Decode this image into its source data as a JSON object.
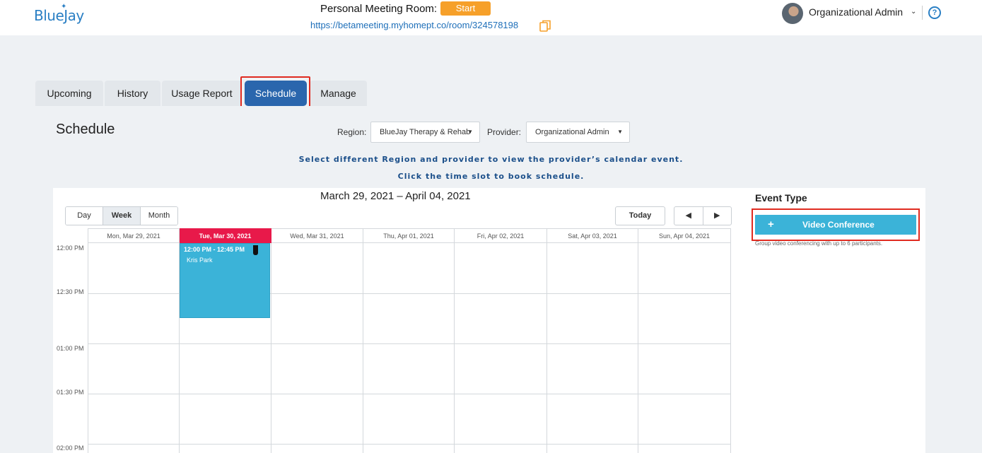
{
  "header": {
    "logo_text": "BlueJay",
    "meeting_room_label": "Personal Meeting Room:",
    "start_label": "Start",
    "room_url": "https://betameeting.myhomept.co/room/324578198",
    "user_name": "Organizational Admin",
    "help_symbol": "?",
    "icons": [
      "copy-icon",
      "avatar",
      "chevron-down-icon",
      "help-icon"
    ]
  },
  "tabs": [
    {
      "label": "Upcoming",
      "active": false
    },
    {
      "label": "History",
      "active": false
    },
    {
      "label": "Usage Report",
      "active": false
    },
    {
      "label": "Schedule",
      "active": true
    },
    {
      "label": "Manage",
      "active": false
    }
  ],
  "schedule": {
    "title": "Schedule",
    "region_label": "Region:",
    "region_value": "BlueJay Therapy & Rehab",
    "provider_label": "Provider:",
    "provider_value": "Organizational Admin",
    "hint_1": "Select different Region and provider to view the provider’s calendar event.",
    "hint_2": "Click the time slot to book schedule."
  },
  "calendar": {
    "range_title": "March 29, 2021 – April 04, 2021",
    "views": [
      {
        "label": "Day",
        "active": false
      },
      {
        "label": "Week",
        "active": true
      },
      {
        "label": "Month",
        "active": false
      }
    ],
    "today_label": "Today",
    "prev_symbol": "◀",
    "next_symbol": "▶",
    "days": [
      {
        "label": "Mon, Mar 29, 2021",
        "today": false
      },
      {
        "label": "Tue, Mar 30, 2021",
        "today": true
      },
      {
        "label": "Wed, Mar 31, 2021",
        "today": false
      },
      {
        "label": "Thu, Apr 01, 2021",
        "today": false
      },
      {
        "label": "Fri, Apr 02, 2021",
        "today": false
      },
      {
        "label": "Sat, Apr 03, 2021",
        "today": false
      },
      {
        "label": "Sun, Apr 04, 2021",
        "today": false
      }
    ],
    "time_slots": [
      "12:00 PM",
      "12:30 PM",
      "01:00 PM",
      "01:30 PM",
      "02:00 PM"
    ],
    "event": {
      "time": "12:00 PM - 12:45 PM",
      "name": "Kris Park",
      "day": "Tue, Mar 30, 2021",
      "color": "#3bb3d8"
    }
  },
  "event_type": {
    "title": "Event Type",
    "button_plus": "+",
    "button_label": "Video Conference",
    "description": "Group video conferencing with up to 6 participants."
  },
  "colors": {
    "accent": "#2a66ad",
    "start_button": "#f6a02a",
    "today_header": "#e8194a",
    "event": "#3bb3d8",
    "highlight_outline": "#e02b20"
  }
}
